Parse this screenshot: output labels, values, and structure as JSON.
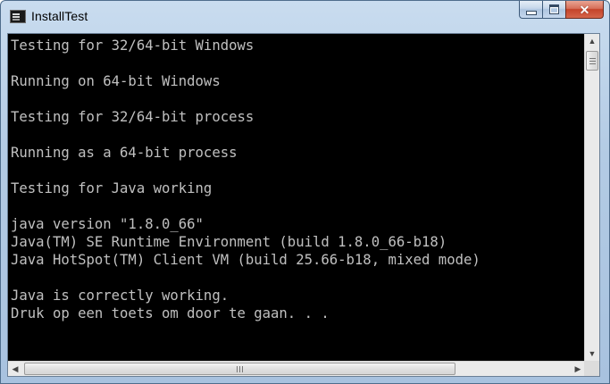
{
  "window": {
    "title": "InstallTest",
    "app_icon": "console-icon",
    "controls": {
      "minimize_icon": "minimize-icon",
      "maximize_icon": "maximize-icon",
      "close_icon": "close-icon",
      "close_glyph": "✕"
    }
  },
  "console": {
    "text_color": "#c0c0c0",
    "background": "#000000",
    "lines": [
      "Testing for 32/64-bit Windows",
      "",
      "Running on 64-bit Windows",
      "",
      "Testing for 32/64-bit process",
      "",
      "Running as a 64-bit process",
      "",
      "Testing for Java working",
      "",
      "java version \"1.8.0_66\"",
      "Java(TM) SE Runtime Environment (build 1.8.0_66-b18)",
      "Java HotSpot(TM) Client VM (build 25.66-b18, mixed mode)",
      "",
      "Java is correctly working.",
      "Druk op een toets om door te gaan. . ."
    ]
  },
  "scrollbars": {
    "up_arrow": "▲",
    "down_arrow": "▼",
    "left_arrow": "◀",
    "right_arrow": "▶"
  }
}
